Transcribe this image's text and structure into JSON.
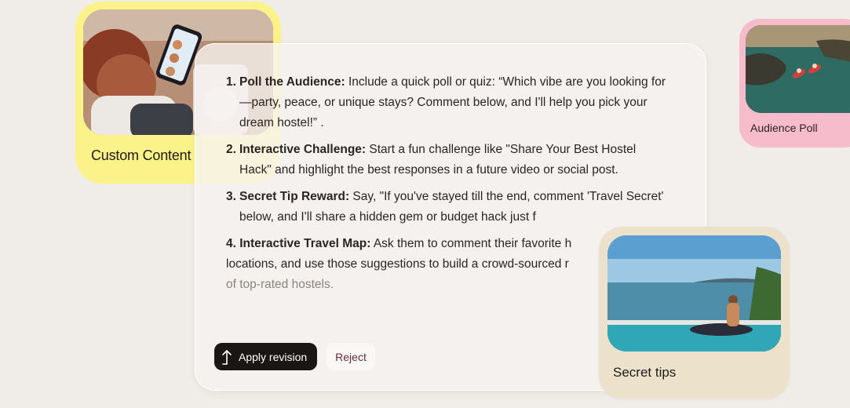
{
  "cards": {
    "custom_content": {
      "label": "Custom Content"
    },
    "audience_poll": {
      "label": "Audience Poll"
    },
    "secret_tips": {
      "label": "Secret tips"
    }
  },
  "suggestions": [
    {
      "number": "1.",
      "title": "Poll the Audience:",
      "text": " Include a quick poll or quiz: “Which vibe are you looking for—party, peace, or unique stays? Comment below, and I'll help you pick your dream hostel!” ."
    },
    {
      "number": "2.",
      "title": "Interactive Challenge:",
      "text": " Start a fun challenge like \"Share Your Best Hostel Hack\" and highlight the best responses in a future video or social post."
    },
    {
      "number": "3.",
      "title": "Secret Tip Reward:",
      "text": " Say, \"If you've stayed till the end, comment 'Travel Secret' below, and I'll share a hidden gem or budget hack just f"
    },
    {
      "number": "4.",
      "title": "Interactive Travel Map:",
      "text": " Ask them to comment their favorite h",
      "line2": "locations, and use those suggestions to build a crowd-sourced r",
      "line3": "of top-rated hostels."
    }
  ],
  "actions": {
    "apply_label": "Apply revision",
    "reject_label": "Reject"
  },
  "icons": {
    "apply": "arrow-up-icon"
  },
  "colors": {
    "yellow_card": "#fbf38a",
    "pink_card": "#f7bccb",
    "beige_card": "#ece2cc",
    "apply_button": "#1a1614",
    "reject_text": "#6b2a3a"
  }
}
